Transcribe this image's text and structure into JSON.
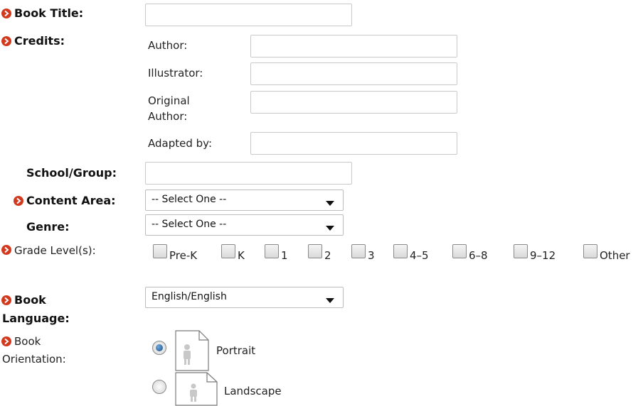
{
  "form": {
    "book_title": {
      "label": "Book Title:",
      "value": ""
    },
    "credits": {
      "label": "Credits:",
      "author": {
        "label": "Author:",
        "value": ""
      },
      "illustrator": {
        "label": "Illustrator:",
        "value": ""
      },
      "original_author": {
        "label_line1": "Original",
        "label_line2": "Author:",
        "value": ""
      },
      "adapted_by": {
        "label": "Adapted by:",
        "value": ""
      }
    },
    "school_group": {
      "label": "School/Group:",
      "value": ""
    },
    "content_area": {
      "label": "Content Area:",
      "selected": "-- Select One --"
    },
    "genre": {
      "label": "Genre:",
      "selected": "-- Select One --"
    },
    "grade_levels": {
      "label": "Grade Level(s):",
      "options": [
        "Pre-K",
        "K",
        "1",
        "2",
        "3",
        "4–5",
        "6–8",
        "9–12",
        "Other"
      ]
    },
    "book_language": {
      "label_line1": "Book",
      "label_line2": "Language:",
      "selected": "English/English"
    },
    "book_orientation": {
      "label_line1": "Book",
      "label_line2": "Orientation:",
      "options": [
        {
          "label": "Portrait",
          "checked": true
        },
        {
          "label": "Landscape",
          "checked": false
        }
      ]
    }
  },
  "colors": {
    "required_marker": "#d23a1f",
    "radio_selected": "#1c4f86"
  },
  "icons": {
    "required": "arrow-right-circle-icon",
    "portrait": "portrait-page-icon",
    "landscape": "landscape-page-icon"
  }
}
